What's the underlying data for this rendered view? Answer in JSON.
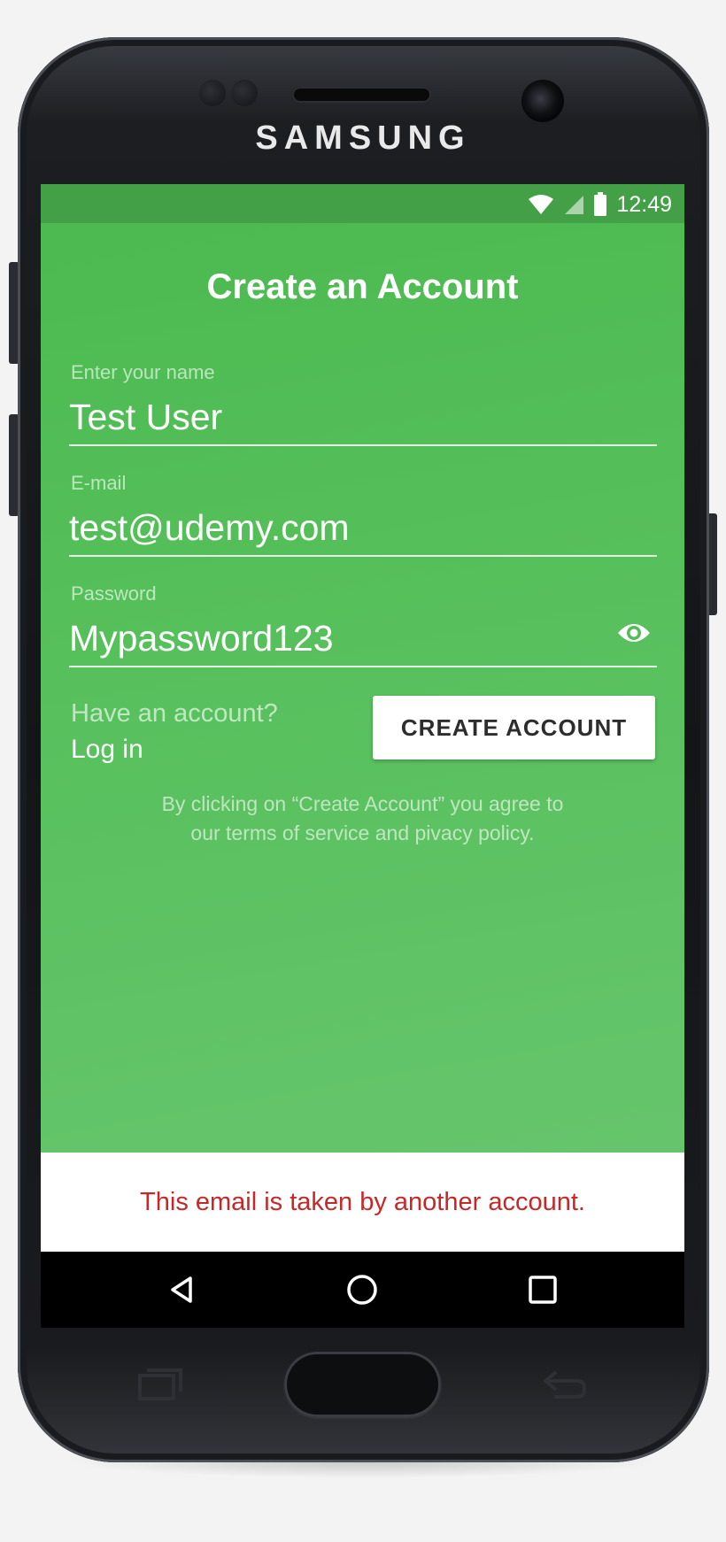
{
  "device": {
    "brand": "SAMSUNG"
  },
  "status_bar": {
    "time": "12:49",
    "icons": [
      "wifi-icon",
      "signal-icon",
      "battery-icon"
    ]
  },
  "screen": {
    "title": "Create an Account",
    "fields": {
      "name": {
        "label": "Enter your name",
        "value": "Test User"
      },
      "email": {
        "label": "E-mail",
        "value": "test@udemy.com"
      },
      "password": {
        "label": "Password",
        "value": "Mypassword123",
        "toggle_icon": "eye-icon"
      }
    },
    "have_account_text": "Have an account?",
    "login_link": "Log in",
    "create_button": "CREATE ACCOUNT",
    "terms_line1": "By clicking on “Create Account” you agree to",
    "terms_line2": "our terms of service and pivacy policy."
  },
  "snackbar": {
    "message": "This email is taken by another account."
  },
  "nav_bar": {
    "items": [
      "back-icon",
      "home-icon",
      "recents-icon"
    ]
  },
  "colors": {
    "accent_green": "#4cba50",
    "status_bar_green": "#43a047",
    "error_red": "#c62828"
  }
}
